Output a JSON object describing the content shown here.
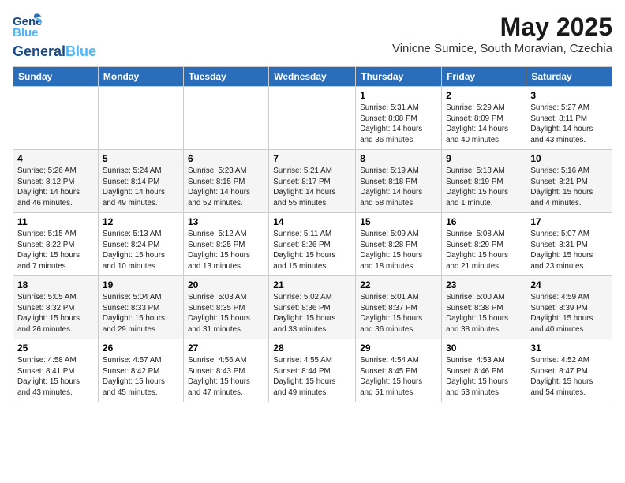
{
  "header": {
    "logo_general": "General",
    "logo_blue": "Blue",
    "month_year": "May 2025",
    "location": "Vinicne Sumice, South Moravian, Czechia"
  },
  "days_of_week": [
    "Sunday",
    "Monday",
    "Tuesday",
    "Wednesday",
    "Thursday",
    "Friday",
    "Saturday"
  ],
  "weeks": [
    [
      {
        "day": "",
        "info": ""
      },
      {
        "day": "",
        "info": ""
      },
      {
        "day": "",
        "info": ""
      },
      {
        "day": "",
        "info": ""
      },
      {
        "day": "1",
        "info": "Sunrise: 5:31 AM\nSunset: 8:08 PM\nDaylight: 14 hours\nand 36 minutes."
      },
      {
        "day": "2",
        "info": "Sunrise: 5:29 AM\nSunset: 8:09 PM\nDaylight: 14 hours\nand 40 minutes."
      },
      {
        "day": "3",
        "info": "Sunrise: 5:27 AM\nSunset: 8:11 PM\nDaylight: 14 hours\nand 43 minutes."
      }
    ],
    [
      {
        "day": "4",
        "info": "Sunrise: 5:26 AM\nSunset: 8:12 PM\nDaylight: 14 hours\nand 46 minutes."
      },
      {
        "day": "5",
        "info": "Sunrise: 5:24 AM\nSunset: 8:14 PM\nDaylight: 14 hours\nand 49 minutes."
      },
      {
        "day": "6",
        "info": "Sunrise: 5:23 AM\nSunset: 8:15 PM\nDaylight: 14 hours\nand 52 minutes."
      },
      {
        "day": "7",
        "info": "Sunrise: 5:21 AM\nSunset: 8:17 PM\nDaylight: 14 hours\nand 55 minutes."
      },
      {
        "day": "8",
        "info": "Sunrise: 5:19 AM\nSunset: 8:18 PM\nDaylight: 14 hours\nand 58 minutes."
      },
      {
        "day": "9",
        "info": "Sunrise: 5:18 AM\nSunset: 8:19 PM\nDaylight: 15 hours\nand 1 minute."
      },
      {
        "day": "10",
        "info": "Sunrise: 5:16 AM\nSunset: 8:21 PM\nDaylight: 15 hours\nand 4 minutes."
      }
    ],
    [
      {
        "day": "11",
        "info": "Sunrise: 5:15 AM\nSunset: 8:22 PM\nDaylight: 15 hours\nand 7 minutes."
      },
      {
        "day": "12",
        "info": "Sunrise: 5:13 AM\nSunset: 8:24 PM\nDaylight: 15 hours\nand 10 minutes."
      },
      {
        "day": "13",
        "info": "Sunrise: 5:12 AM\nSunset: 8:25 PM\nDaylight: 15 hours\nand 13 minutes."
      },
      {
        "day": "14",
        "info": "Sunrise: 5:11 AM\nSunset: 8:26 PM\nDaylight: 15 hours\nand 15 minutes."
      },
      {
        "day": "15",
        "info": "Sunrise: 5:09 AM\nSunset: 8:28 PM\nDaylight: 15 hours\nand 18 minutes."
      },
      {
        "day": "16",
        "info": "Sunrise: 5:08 AM\nSunset: 8:29 PM\nDaylight: 15 hours\nand 21 minutes."
      },
      {
        "day": "17",
        "info": "Sunrise: 5:07 AM\nSunset: 8:31 PM\nDaylight: 15 hours\nand 23 minutes."
      }
    ],
    [
      {
        "day": "18",
        "info": "Sunrise: 5:05 AM\nSunset: 8:32 PM\nDaylight: 15 hours\nand 26 minutes."
      },
      {
        "day": "19",
        "info": "Sunrise: 5:04 AM\nSunset: 8:33 PM\nDaylight: 15 hours\nand 29 minutes."
      },
      {
        "day": "20",
        "info": "Sunrise: 5:03 AM\nSunset: 8:35 PM\nDaylight: 15 hours\nand 31 minutes."
      },
      {
        "day": "21",
        "info": "Sunrise: 5:02 AM\nSunset: 8:36 PM\nDaylight: 15 hours\nand 33 minutes."
      },
      {
        "day": "22",
        "info": "Sunrise: 5:01 AM\nSunset: 8:37 PM\nDaylight: 15 hours\nand 36 minutes."
      },
      {
        "day": "23",
        "info": "Sunrise: 5:00 AM\nSunset: 8:38 PM\nDaylight: 15 hours\nand 38 minutes."
      },
      {
        "day": "24",
        "info": "Sunrise: 4:59 AM\nSunset: 8:39 PM\nDaylight: 15 hours\nand 40 minutes."
      }
    ],
    [
      {
        "day": "25",
        "info": "Sunrise: 4:58 AM\nSunset: 8:41 PM\nDaylight: 15 hours\nand 43 minutes."
      },
      {
        "day": "26",
        "info": "Sunrise: 4:57 AM\nSunset: 8:42 PM\nDaylight: 15 hours\nand 45 minutes."
      },
      {
        "day": "27",
        "info": "Sunrise: 4:56 AM\nSunset: 8:43 PM\nDaylight: 15 hours\nand 47 minutes."
      },
      {
        "day": "28",
        "info": "Sunrise: 4:55 AM\nSunset: 8:44 PM\nDaylight: 15 hours\nand 49 minutes."
      },
      {
        "day": "29",
        "info": "Sunrise: 4:54 AM\nSunset: 8:45 PM\nDaylight: 15 hours\nand 51 minutes."
      },
      {
        "day": "30",
        "info": "Sunrise: 4:53 AM\nSunset: 8:46 PM\nDaylight: 15 hours\nand 53 minutes."
      },
      {
        "day": "31",
        "info": "Sunrise: 4:52 AM\nSunset: 8:47 PM\nDaylight: 15 hours\nand 54 minutes."
      }
    ]
  ]
}
